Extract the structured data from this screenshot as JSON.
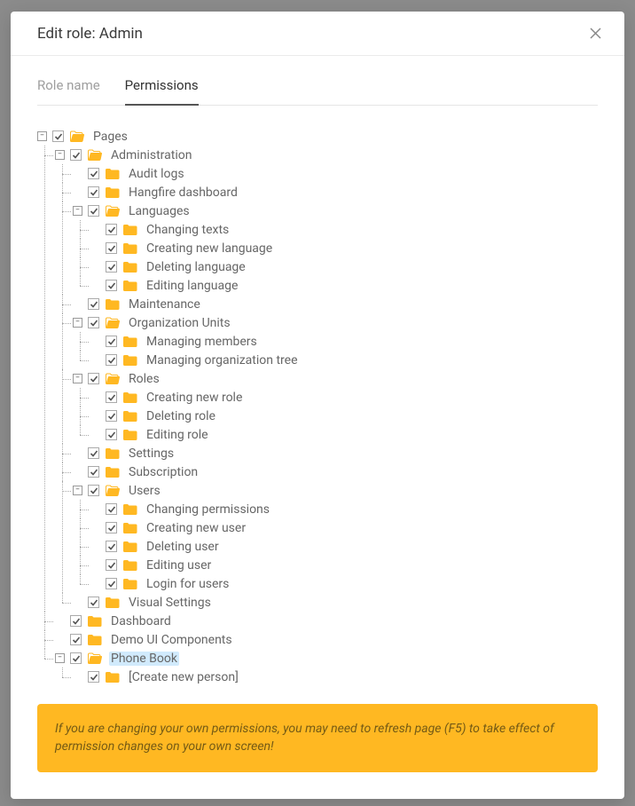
{
  "modal": {
    "title": "Edit role: Admin"
  },
  "tabs": {
    "role_name": "Role name",
    "permissions": "Permissions"
  },
  "warning": "If you are changing your own permissions, you may need to refresh page (F5) to take effect of permission changes on your own screen!",
  "colors": {
    "accent": "#ffb822"
  },
  "tree": [
    {
      "label": "Pages",
      "checked": true,
      "expanded": true,
      "open": true,
      "children": [
        {
          "label": "Administration",
          "checked": true,
          "expanded": true,
          "open": true,
          "children": [
            {
              "label": "Audit logs",
              "checked": true
            },
            {
              "label": "Hangfire dashboard",
              "checked": true
            },
            {
              "label": "Languages",
              "checked": true,
              "expanded": true,
              "open": true,
              "children": [
                {
                  "label": "Changing texts",
                  "checked": true
                },
                {
                  "label": "Creating new language",
                  "checked": true
                },
                {
                  "label": "Deleting language",
                  "checked": true
                },
                {
                  "label": "Editing language",
                  "checked": true
                }
              ]
            },
            {
              "label": "Maintenance",
              "checked": true
            },
            {
              "label": "Organization Units",
              "checked": true,
              "expanded": true,
              "open": true,
              "children": [
                {
                  "label": "Managing members",
                  "checked": true
                },
                {
                  "label": "Managing organization tree",
                  "checked": true
                }
              ]
            },
            {
              "label": "Roles",
              "checked": true,
              "expanded": true,
              "open": true,
              "children": [
                {
                  "label": "Creating new role",
                  "checked": true
                },
                {
                  "label": "Deleting role",
                  "checked": true
                },
                {
                  "label": "Editing role",
                  "checked": true
                }
              ]
            },
            {
              "label": "Settings",
              "checked": true
            },
            {
              "label": "Subscription",
              "checked": true
            },
            {
              "label": "Users",
              "checked": true,
              "expanded": true,
              "open": true,
              "children": [
                {
                  "label": "Changing permissions",
                  "checked": true
                },
                {
                  "label": "Creating new user",
                  "checked": true
                },
                {
                  "label": "Deleting user",
                  "checked": true
                },
                {
                  "label": "Editing user",
                  "checked": true
                },
                {
                  "label": "Login for users",
                  "checked": true
                }
              ]
            },
            {
              "label": "Visual Settings",
              "checked": true
            }
          ]
        },
        {
          "label": "Dashboard",
          "checked": true
        },
        {
          "label": "Demo UI Components",
          "checked": true
        },
        {
          "label": "Phone Book",
          "checked": true,
          "expanded": true,
          "open": true,
          "selected": true,
          "children": [
            {
              "label": "[Create new person]",
              "checked": true
            }
          ]
        }
      ]
    }
  ]
}
